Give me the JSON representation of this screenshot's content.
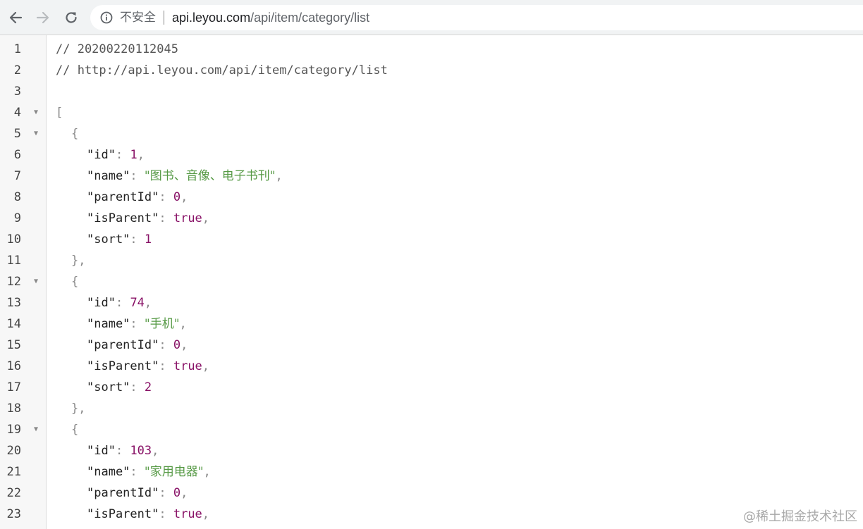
{
  "browser": {
    "security_label": "不安全",
    "url_host": "api.leyou.com",
    "url_path": "/api/item/category/list"
  },
  "code": {
    "lines": [
      {
        "n": "1",
        "fold": false,
        "indent": 0,
        "tokens": [
          {
            "t": "// 20200220112045",
            "c": "cm"
          }
        ]
      },
      {
        "n": "2",
        "fold": false,
        "indent": 0,
        "tokens": [
          {
            "t": "// http://api.leyou.com/api/item/category/list",
            "c": "cm"
          }
        ]
      },
      {
        "n": "3",
        "fold": false,
        "indent": 0,
        "tokens": []
      },
      {
        "n": "4",
        "fold": true,
        "indent": 0,
        "tokens": [
          {
            "t": "[",
            "c": "pn"
          }
        ]
      },
      {
        "n": "5",
        "fold": true,
        "indent": 1,
        "tokens": [
          {
            "t": "{",
            "c": "pn"
          }
        ]
      },
      {
        "n": "6",
        "fold": false,
        "indent": 2,
        "tokens": [
          {
            "t": "\"id\"",
            "c": "key"
          },
          {
            "t": ": ",
            "c": "pn"
          },
          {
            "t": "1",
            "c": "num"
          },
          {
            "t": ",",
            "c": "pn"
          }
        ]
      },
      {
        "n": "7",
        "fold": false,
        "indent": 2,
        "tokens": [
          {
            "t": "\"name\"",
            "c": "key"
          },
          {
            "t": ": ",
            "c": "pn"
          },
          {
            "t": "\"图书、音像、电子书刊\"",
            "c": "str"
          },
          {
            "t": ",",
            "c": "pn"
          }
        ]
      },
      {
        "n": "8",
        "fold": false,
        "indent": 2,
        "tokens": [
          {
            "t": "\"parentId\"",
            "c": "key"
          },
          {
            "t": ": ",
            "c": "pn"
          },
          {
            "t": "0",
            "c": "num"
          },
          {
            "t": ",",
            "c": "pn"
          }
        ]
      },
      {
        "n": "9",
        "fold": false,
        "indent": 2,
        "tokens": [
          {
            "t": "\"isParent\"",
            "c": "key"
          },
          {
            "t": ": ",
            "c": "pn"
          },
          {
            "t": "true",
            "c": "bool"
          },
          {
            "t": ",",
            "c": "pn"
          }
        ]
      },
      {
        "n": "10",
        "fold": false,
        "indent": 2,
        "tokens": [
          {
            "t": "\"sort\"",
            "c": "key"
          },
          {
            "t": ": ",
            "c": "pn"
          },
          {
            "t": "1",
            "c": "num"
          }
        ]
      },
      {
        "n": "11",
        "fold": false,
        "indent": 1,
        "tokens": [
          {
            "t": "},",
            "c": "pn"
          }
        ]
      },
      {
        "n": "12",
        "fold": true,
        "indent": 1,
        "tokens": [
          {
            "t": "{",
            "c": "pn"
          }
        ]
      },
      {
        "n": "13",
        "fold": false,
        "indent": 2,
        "tokens": [
          {
            "t": "\"id\"",
            "c": "key"
          },
          {
            "t": ": ",
            "c": "pn"
          },
          {
            "t": "74",
            "c": "num"
          },
          {
            "t": ",",
            "c": "pn"
          }
        ]
      },
      {
        "n": "14",
        "fold": false,
        "indent": 2,
        "tokens": [
          {
            "t": "\"name\"",
            "c": "key"
          },
          {
            "t": ": ",
            "c": "pn"
          },
          {
            "t": "\"手机\"",
            "c": "str"
          },
          {
            "t": ",",
            "c": "pn"
          }
        ]
      },
      {
        "n": "15",
        "fold": false,
        "indent": 2,
        "tokens": [
          {
            "t": "\"parentId\"",
            "c": "key"
          },
          {
            "t": ": ",
            "c": "pn"
          },
          {
            "t": "0",
            "c": "num"
          },
          {
            "t": ",",
            "c": "pn"
          }
        ]
      },
      {
        "n": "16",
        "fold": false,
        "indent": 2,
        "tokens": [
          {
            "t": "\"isParent\"",
            "c": "key"
          },
          {
            "t": ": ",
            "c": "pn"
          },
          {
            "t": "true",
            "c": "bool"
          },
          {
            "t": ",",
            "c": "pn"
          }
        ]
      },
      {
        "n": "17",
        "fold": false,
        "indent": 2,
        "tokens": [
          {
            "t": "\"sort\"",
            "c": "key"
          },
          {
            "t": ": ",
            "c": "pn"
          },
          {
            "t": "2",
            "c": "num"
          }
        ]
      },
      {
        "n": "18",
        "fold": false,
        "indent": 1,
        "tokens": [
          {
            "t": "},",
            "c": "pn"
          }
        ]
      },
      {
        "n": "19",
        "fold": true,
        "indent": 1,
        "tokens": [
          {
            "t": "{",
            "c": "pn"
          }
        ]
      },
      {
        "n": "20",
        "fold": false,
        "indent": 2,
        "tokens": [
          {
            "t": "\"id\"",
            "c": "key"
          },
          {
            "t": ": ",
            "c": "pn"
          },
          {
            "t": "103",
            "c": "num"
          },
          {
            "t": ",",
            "c": "pn"
          }
        ]
      },
      {
        "n": "21",
        "fold": false,
        "indent": 2,
        "tokens": [
          {
            "t": "\"name\"",
            "c": "key"
          },
          {
            "t": ": ",
            "c": "pn"
          },
          {
            "t": "\"家用电器\"",
            "c": "str"
          },
          {
            "t": ",",
            "c": "pn"
          }
        ]
      },
      {
        "n": "22",
        "fold": false,
        "indent": 2,
        "tokens": [
          {
            "t": "\"parentId\"",
            "c": "key"
          },
          {
            "t": ": ",
            "c": "pn"
          },
          {
            "t": "0",
            "c": "num"
          },
          {
            "t": ",",
            "c": "pn"
          }
        ]
      },
      {
        "n": "23",
        "fold": false,
        "indent": 2,
        "tokens": [
          {
            "t": "\"isParent\"",
            "c": "key"
          },
          {
            "t": ": ",
            "c": "pn"
          },
          {
            "t": "true",
            "c": "bool"
          },
          {
            "t": ",",
            "c": "pn"
          }
        ]
      }
    ]
  },
  "watermark": "@稀土掘金技术社区",
  "colors": {
    "toolbar_bg": "#f1f3f4",
    "string": "#559944",
    "number": "#881166",
    "gutter_bg": "#f7f7f7"
  }
}
